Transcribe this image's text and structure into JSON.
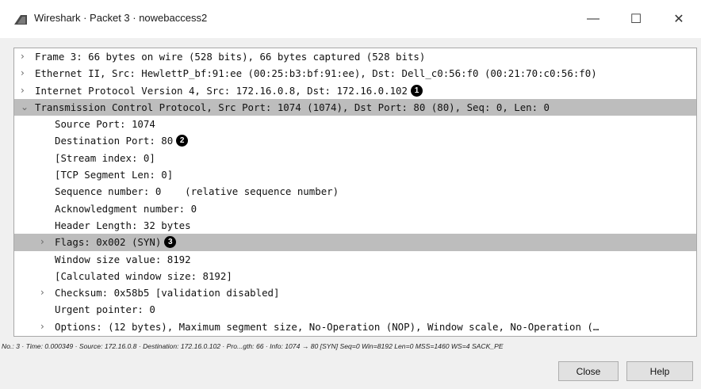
{
  "window": {
    "title": "Wireshark · Packet 3 · nowebaccess2",
    "minimize_glyph": "—",
    "maximize_glyph": "☐",
    "close_glyph": "✕"
  },
  "tree": [
    {
      "indent": 0,
      "arrow": "›",
      "text": "Frame 3: 66 bytes on wire (528 bits), 66 bytes captured (528 bits)",
      "selected": false
    },
    {
      "indent": 0,
      "arrow": "›",
      "text": "Ethernet II, Src: HewlettP_bf:91:ee (00:25:b3:bf:91:ee), Dst: Dell_c0:56:f0 (00:21:70:c0:56:f0)",
      "selected": false
    },
    {
      "indent": 0,
      "arrow": "›",
      "text": "Internet Protocol Version 4, Src: 172.16.0.8, Dst: 172.16.0.102",
      "selected": false,
      "badge": "1"
    },
    {
      "indent": 0,
      "arrow": "⌄",
      "text": "Transmission Control Protocol, Src Port: 1074 (1074), Dst Port: 80 (80), Seq: 0, Len: 0",
      "selected": true
    },
    {
      "indent": 1,
      "arrow": "",
      "text": "Source Port: 1074",
      "selected": false
    },
    {
      "indent": 1,
      "arrow": "",
      "text": "Destination Port: 80",
      "selected": false,
      "badge": "2"
    },
    {
      "indent": 1,
      "arrow": "",
      "text": "[Stream index: 0]",
      "selected": false
    },
    {
      "indent": 1,
      "arrow": "",
      "text": "[TCP Segment Len: 0]",
      "selected": false
    },
    {
      "indent": 1,
      "arrow": "",
      "text": "Sequence number: 0    (relative sequence number)",
      "selected": false
    },
    {
      "indent": 1,
      "arrow": "",
      "text": "Acknowledgment number: 0",
      "selected": false
    },
    {
      "indent": 1,
      "arrow": "",
      "text": "Header Length: 32 bytes",
      "selected": false
    },
    {
      "indent": 1,
      "arrow": "›",
      "text": "Flags: 0x002 (SYN)",
      "selected": true,
      "badge": "3"
    },
    {
      "indent": 1,
      "arrow": "",
      "text": "Window size value: 8192",
      "selected": false
    },
    {
      "indent": 1,
      "arrow": "",
      "text": "[Calculated window size: 8192]",
      "selected": false
    },
    {
      "indent": 1,
      "arrow": "›",
      "text": "Checksum: 0x58b5 [validation disabled]",
      "selected": false
    },
    {
      "indent": 1,
      "arrow": "",
      "text": "Urgent pointer: 0",
      "selected": false
    },
    {
      "indent": 1,
      "arrow": "›",
      "text": "Options: (12 bytes), Maximum segment size, No-Operation (NOP), Window scale, No-Operation (…",
      "selected": false
    }
  ],
  "status": "No.: 3 · Time: 0.000349 · Source: 172.16.0.8 · Destination: 172.16.0.102 · Pro...gth: 66 · Info: 1074 → 80 [SYN] Seq=0 Win=8192 Len=0 MSS=1460 WS=4 SACK_PE",
  "buttons": {
    "close": "Close",
    "help": "Help"
  },
  "icons": {
    "app": "wireshark-fin-icon"
  },
  "colors": {
    "selection": "#bdbdbd",
    "badge": "#000000"
  }
}
